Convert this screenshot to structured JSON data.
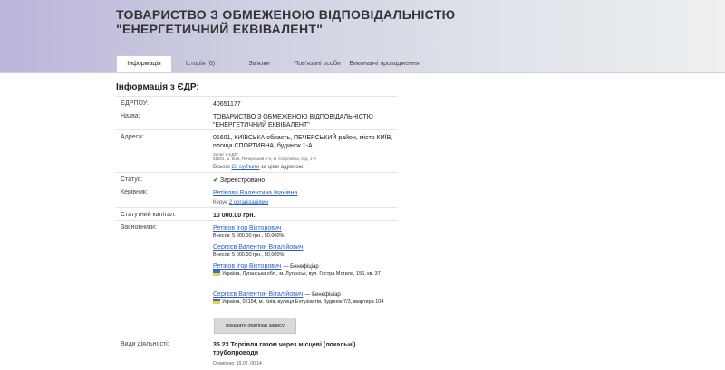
{
  "header": {
    "title": "ТОВАРИСТВО З ОБМЕЖЕНОЮ ВІДПОВІДАЛЬНІСТЮ \"ЕНЕРГЕТИЧНИЙ ЕКВІВАЛЕНТ\""
  },
  "tabs": [
    {
      "label": "Інформація"
    },
    {
      "label": "Історія (6)"
    },
    {
      "label": "Зв'язки"
    },
    {
      "label": "Пов'язані особи"
    },
    {
      "label": "Виконавчі провадження"
    }
  ],
  "section_title": "Інформація з ЄДР:",
  "rows": {
    "edrpou": {
      "label": "ЄДРПОУ:",
      "value": "40651177"
    },
    "name": {
      "label": "Назва:",
      "value": "ТОВАРИСТВО З ОБМЕЖЕНОЮ ВІДПОВІДАЛЬНІСТЮ \"ЕНЕРГЕТИЧНИЙ ЕКВІВАЛЕНТ\""
    },
    "address": {
      "label": "Адреса:",
      "value": "01601, КИЇВСЬКА область, ПЕЧЕРСЬКИЙ район, місто КИЇВ, площа СПОРТИВНА, будинок 1-А",
      "note_1": "Запис в ЄДР:",
      "note_2": "01601, м. Київ, Печерський р-н, м. Спортивна, буд. 1-А",
      "total_prefix": "Всього",
      "total_link": "23 суб'єкти",
      "total_suffix": "за цією адресою"
    },
    "status": {
      "label": "Статус:",
      "value": "Зареєстровано",
      "icon": "check-icon"
    },
    "head": {
      "label": "Керівник:",
      "name": "Ретівова Валентина Іванівна",
      "manages_prefix": "Керує",
      "manages_link": "2 організаціями"
    },
    "capital": {
      "label": "Статутний капітал:",
      "value": "10 000.00 грн."
    },
    "founders": {
      "label": "Засновники:",
      "items": [
        {
          "name": "Ретівов Ігор Вікторович",
          "detail": "Внесок: 5 000.00 грн., 50,000%"
        },
        {
          "name": "Сергєєв Валентин Віталійович",
          "detail": "Внесок: 5 000.00 грн., 50,000%"
        }
      ],
      "beneficiaries": [
        {
          "name": "Ретівов Ігор Вікторович",
          "role": "— Бенефіціар",
          "address": "Україна, Луганська обл., м. Луганськ, вул. Гостра Могила, 156, кв. 37"
        },
        {
          "name": "Сергєєв Валентин Віталійович",
          "role": "— Бенефіціар",
          "address": "Україна, 02154, м. Київ, вулиця Ентузіастів, будинок 7/3, квартира 104"
        }
      ],
      "button_label": "показати оригінал запису"
    },
    "activity": {
      "label": "Види діяльності:",
      "value": "35.23 Торгівля газом через місцеві (локальні) трубопроводи"
    }
  },
  "updated": "Оновлено: 19.02, 00:14",
  "colors": {
    "link": "#2a5fbd",
    "check": "#2c8a2c"
  }
}
